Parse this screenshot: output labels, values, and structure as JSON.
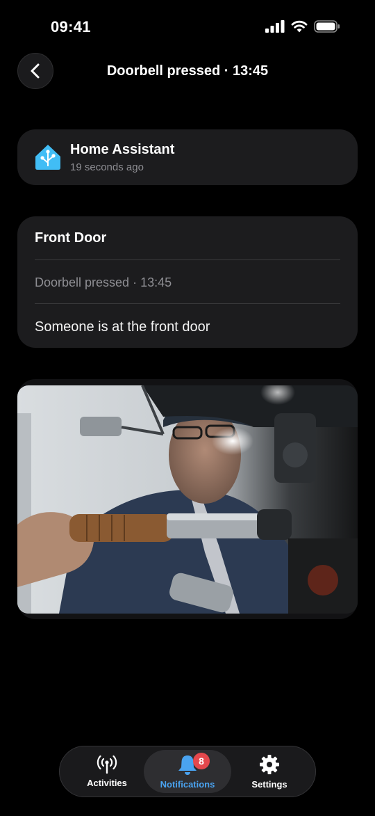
{
  "status_bar": {
    "time": "09:41"
  },
  "header": {
    "title": "Doorbell pressed · 13:45",
    "back_icon": "chevron-left-icon"
  },
  "app_card": {
    "app_name": "Home Assistant",
    "time_ago": "19 seconds ago",
    "logo_icon": "home-assistant-logo",
    "logo_color": "#41bdf5"
  },
  "notification": {
    "title": "Front Door",
    "subtitle": "Doorbell pressed · 13:45",
    "message": "Someone is at the front door"
  },
  "nav": {
    "items": [
      {
        "label": "Activities",
        "icon": "broadcast-icon"
      },
      {
        "label": "Notifications",
        "icon": "bell-icon",
        "badge": "8"
      },
      {
        "label": "Settings",
        "icon": "gear-icon"
      }
    ],
    "active_color": "#4aa3f0",
    "badge_color": "#e5484d"
  }
}
